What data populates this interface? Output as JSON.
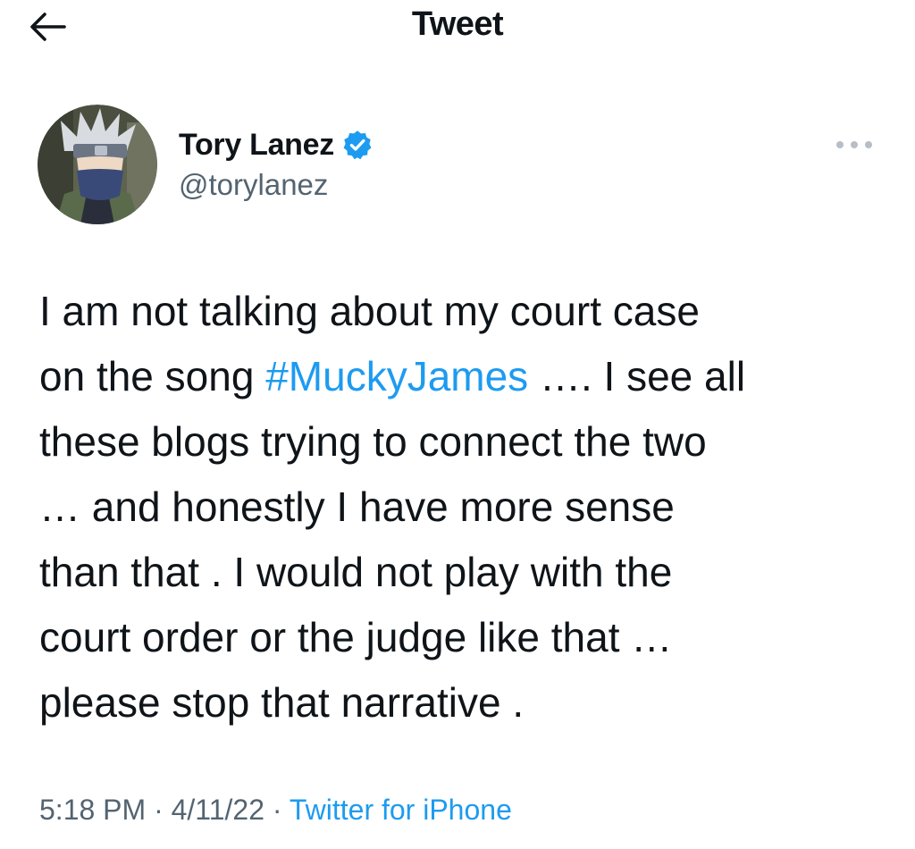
{
  "header": {
    "title": "Tweet",
    "back_icon": "arrow-left-icon"
  },
  "author": {
    "name": "Tory Lanez",
    "handle": "@torylanez",
    "verified": true,
    "verified_icon": "verified-badge-icon",
    "avatar_icon": "avatar-image",
    "more_icon": "more-horizontal-icon"
  },
  "tweet": {
    "lines": [
      {
        "text": "I am not talking about my court case"
      },
      {
        "pre": "on the song ",
        "hashtag": "#MuckyJames",
        "post": " …. I see all"
      },
      {
        "text": "these blogs trying to connect the two"
      },
      {
        "text": "… and honestly I have more sense"
      },
      {
        "text": "than that . I would not play with the"
      },
      {
        "text": "court order or the judge like that …"
      },
      {
        "text": "please stop that narrative ."
      }
    ]
  },
  "meta": {
    "time": "5:18 PM",
    "sep1": " · ",
    "date": "4/11/22",
    "sep2": " · ",
    "source": "Twitter for iPhone"
  },
  "colors": {
    "accent": "#1d9bf0",
    "text": "#0f1419",
    "secondary": "#536471"
  }
}
